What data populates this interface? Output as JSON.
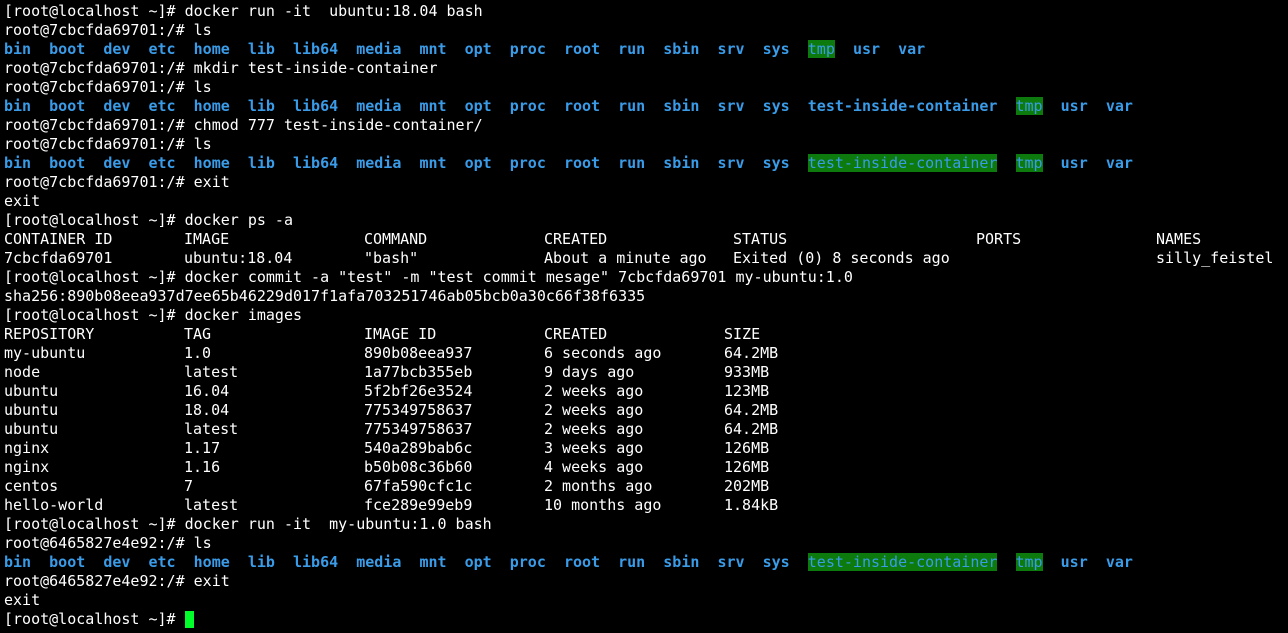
{
  "terminal": {
    "colors": {
      "background": "#000000",
      "text": "#ffffff",
      "directory": "#3a9ce8",
      "highlight_bg": "#0c7a0c",
      "cursor": "#00ff2a"
    },
    "lines": [
      {
        "type": "text",
        "text": "[root@localhost ~]# docker run -it  ubuntu:18.04 bash"
      },
      {
        "type": "text",
        "text": "root@7cbcfda69701:/# ls"
      },
      {
        "type": "ls",
        "items": [
          {
            "t": "bin",
            "s": "dir"
          },
          {
            "t": "boot",
            "s": "dir"
          },
          {
            "t": "dev",
            "s": "dir"
          },
          {
            "t": "etc",
            "s": "dir"
          },
          {
            "t": "home",
            "s": "dir"
          },
          {
            "t": "lib",
            "s": "dir"
          },
          {
            "t": "lib64",
            "s": "dir"
          },
          {
            "t": "media",
            "s": "dir"
          },
          {
            "t": "mnt",
            "s": "dir"
          },
          {
            "t": "opt",
            "s": "dir"
          },
          {
            "t": "proc",
            "s": "dir"
          },
          {
            "t": "root",
            "s": "dir"
          },
          {
            "t": "run",
            "s": "dir"
          },
          {
            "t": "sbin",
            "s": "dir"
          },
          {
            "t": "srv",
            "s": "dir"
          },
          {
            "t": "sys",
            "s": "dir"
          },
          {
            "t": "tmp",
            "s": "hl"
          },
          {
            "t": "usr",
            "s": "dir"
          },
          {
            "t": "var",
            "s": "dir"
          }
        ]
      },
      {
        "type": "text",
        "text": "root@7cbcfda69701:/# mkdir test-inside-container"
      },
      {
        "type": "text",
        "text": "root@7cbcfda69701:/# ls"
      },
      {
        "type": "ls",
        "items": [
          {
            "t": "bin",
            "s": "dir"
          },
          {
            "t": "boot",
            "s": "dir"
          },
          {
            "t": "dev",
            "s": "dir"
          },
          {
            "t": "etc",
            "s": "dir"
          },
          {
            "t": "home",
            "s": "dir"
          },
          {
            "t": "lib",
            "s": "dir"
          },
          {
            "t": "lib64",
            "s": "dir"
          },
          {
            "t": "media",
            "s": "dir"
          },
          {
            "t": "mnt",
            "s": "dir"
          },
          {
            "t": "opt",
            "s": "dir"
          },
          {
            "t": "proc",
            "s": "dir"
          },
          {
            "t": "root",
            "s": "dir"
          },
          {
            "t": "run",
            "s": "dir"
          },
          {
            "t": "sbin",
            "s": "dir"
          },
          {
            "t": "srv",
            "s": "dir"
          },
          {
            "t": "sys",
            "s": "dir"
          },
          {
            "t": "test-inside-container",
            "s": "dir"
          },
          {
            "t": "tmp",
            "s": "hl"
          },
          {
            "t": "usr",
            "s": "dir"
          },
          {
            "t": "var",
            "s": "dir"
          }
        ]
      },
      {
        "type": "text",
        "text": "root@7cbcfda69701:/# chmod 777 test-inside-container/"
      },
      {
        "type": "text",
        "text": "root@7cbcfda69701:/# ls"
      },
      {
        "type": "ls",
        "items": [
          {
            "t": "bin",
            "s": "dir"
          },
          {
            "t": "boot",
            "s": "dir"
          },
          {
            "t": "dev",
            "s": "dir"
          },
          {
            "t": "etc",
            "s": "dir"
          },
          {
            "t": "home",
            "s": "dir"
          },
          {
            "t": "lib",
            "s": "dir"
          },
          {
            "t": "lib64",
            "s": "dir"
          },
          {
            "t": "media",
            "s": "dir"
          },
          {
            "t": "mnt",
            "s": "dir"
          },
          {
            "t": "opt",
            "s": "dir"
          },
          {
            "t": "proc",
            "s": "dir"
          },
          {
            "t": "root",
            "s": "dir"
          },
          {
            "t": "run",
            "s": "dir"
          },
          {
            "t": "sbin",
            "s": "dir"
          },
          {
            "t": "srv",
            "s": "dir"
          },
          {
            "t": "sys",
            "s": "dir"
          },
          {
            "t": "test-inside-container",
            "s": "hl"
          },
          {
            "t": "tmp",
            "s": "hl"
          },
          {
            "t": "usr",
            "s": "dir"
          },
          {
            "t": "var",
            "s": "dir"
          }
        ]
      },
      {
        "type": "text",
        "text": "root@7cbcfda69701:/# exit"
      },
      {
        "type": "text",
        "text": "exit"
      },
      {
        "type": "text",
        "text": "[root@localhost ~]# docker ps -a"
      },
      {
        "type": "row",
        "table": "ps",
        "cells": [
          "CONTAINER ID",
          "IMAGE",
          "COMMAND",
          "CREATED",
          "STATUS",
          "PORTS",
          "NAMES"
        ]
      },
      {
        "type": "row",
        "table": "ps",
        "cells": [
          "7cbcfda69701",
          "ubuntu:18.04",
          "\"bash\"",
          "About a minute ago",
          "Exited (0) 8 seconds ago",
          "",
          "silly_feistel"
        ]
      },
      {
        "type": "text",
        "text": "[root@localhost ~]# docker commit -a \"test\" -m \"test commit mesage\" 7cbcfda69701 my-ubuntu:1.0"
      },
      {
        "type": "text",
        "text": "sha256:890b08eea937d7ee65b46229d017f1afa703251746ab05bcb0a30c66f38f6335"
      },
      {
        "type": "text",
        "text": "[root@localhost ~]# docker images"
      },
      {
        "type": "row",
        "table": "images",
        "cells": [
          "REPOSITORY",
          "TAG",
          "IMAGE ID",
          "CREATED",
          "SIZE"
        ]
      },
      {
        "type": "row",
        "table": "images",
        "cells": [
          "my-ubuntu",
          "1.0",
          "890b08eea937",
          "6 seconds ago",
          "64.2MB"
        ]
      },
      {
        "type": "row",
        "table": "images",
        "cells": [
          "node",
          "latest",
          "1a77bcb355eb",
          "9 days ago",
          "933MB"
        ]
      },
      {
        "type": "row",
        "table": "images",
        "cells": [
          "ubuntu",
          "16.04",
          "5f2bf26e3524",
          "2 weeks ago",
          "123MB"
        ]
      },
      {
        "type": "row",
        "table": "images",
        "cells": [
          "ubuntu",
          "18.04",
          "775349758637",
          "2 weeks ago",
          "64.2MB"
        ]
      },
      {
        "type": "row",
        "table": "images",
        "cells": [
          "ubuntu",
          "latest",
          "775349758637",
          "2 weeks ago",
          "64.2MB"
        ]
      },
      {
        "type": "row",
        "table": "images",
        "cells": [
          "nginx",
          "1.17",
          "540a289bab6c",
          "3 weeks ago",
          "126MB"
        ]
      },
      {
        "type": "row",
        "table": "images",
        "cells": [
          "nginx",
          "1.16",
          "b50b08c36b60",
          "4 weeks ago",
          "126MB"
        ]
      },
      {
        "type": "row",
        "table": "images",
        "cells": [
          "centos",
          "7",
          "67fa590cfc1c",
          "2 months ago",
          "202MB"
        ]
      },
      {
        "type": "row",
        "table": "images",
        "cells": [
          "hello-world",
          "latest",
          "fce289e99eb9",
          "10 months ago",
          "1.84kB"
        ]
      },
      {
        "type": "text",
        "text": "[root@localhost ~]# docker run -it  my-ubuntu:1.0 bash"
      },
      {
        "type": "text",
        "text": "root@6465827e4e92:/# ls"
      },
      {
        "type": "ls",
        "items": [
          {
            "t": "bin",
            "s": "dir"
          },
          {
            "t": "boot",
            "s": "dir"
          },
          {
            "t": "dev",
            "s": "dir"
          },
          {
            "t": "etc",
            "s": "dir"
          },
          {
            "t": "home",
            "s": "dir"
          },
          {
            "t": "lib",
            "s": "dir"
          },
          {
            "t": "lib64",
            "s": "dir"
          },
          {
            "t": "media",
            "s": "dir"
          },
          {
            "t": "mnt",
            "s": "dir"
          },
          {
            "t": "opt",
            "s": "dir"
          },
          {
            "t": "proc",
            "s": "dir"
          },
          {
            "t": "root",
            "s": "dir"
          },
          {
            "t": "run",
            "s": "dir"
          },
          {
            "t": "sbin",
            "s": "dir"
          },
          {
            "t": "srv",
            "s": "dir"
          },
          {
            "t": "sys",
            "s": "dir"
          },
          {
            "t": "test-inside-container",
            "s": "hl"
          },
          {
            "t": "tmp",
            "s": "hl"
          },
          {
            "t": "usr",
            "s": "dir"
          },
          {
            "t": "var",
            "s": "dir"
          }
        ]
      },
      {
        "type": "text",
        "text": "root@6465827e4e92:/# exit"
      },
      {
        "type": "text",
        "text": "exit"
      },
      {
        "type": "prompt",
        "text": "[root@localhost ~]# "
      }
    ]
  }
}
